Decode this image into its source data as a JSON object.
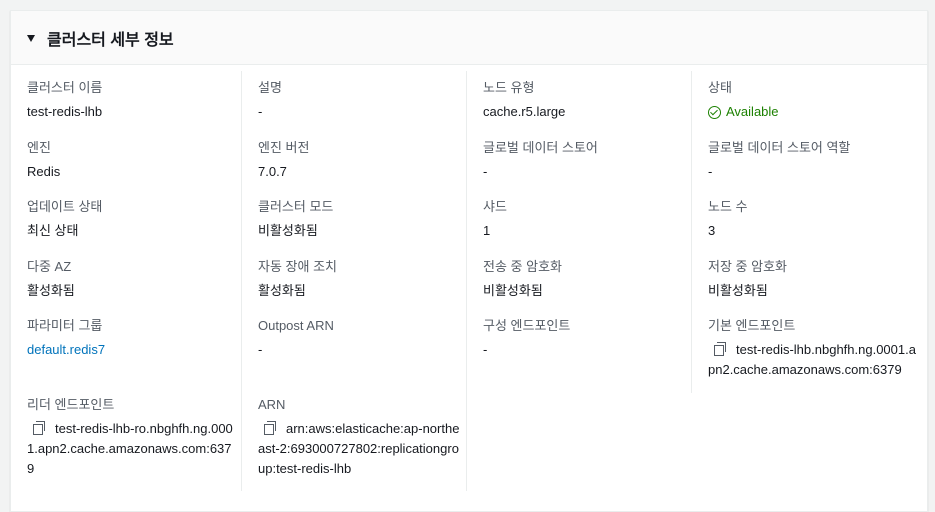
{
  "panel": {
    "title": "클러스터 세부 정보"
  },
  "fields": {
    "cluster_name": {
      "label": "클러스터 이름",
      "value": "test-redis-lhb"
    },
    "description": {
      "label": "설명",
      "value": "-"
    },
    "node_type": {
      "label": "노드 유형",
      "value": "cache.r5.large"
    },
    "status": {
      "label": "상태",
      "value": "Available"
    },
    "engine": {
      "label": "엔진",
      "value": "Redis"
    },
    "engine_version": {
      "label": "엔진 버전",
      "value": "7.0.7"
    },
    "global_datastore": {
      "label": "글로벌 데이터 스토어",
      "value": "-"
    },
    "global_datastore_role": {
      "label": "글로벌 데이터 스토어 역할",
      "value": "-"
    },
    "update_status": {
      "label": "업데이트 상태",
      "value": "최신 상태"
    },
    "cluster_mode": {
      "label": "클러스터 모드",
      "value": "비활성화됨"
    },
    "shards": {
      "label": "샤드",
      "value": "1"
    },
    "node_count": {
      "label": "노드 수",
      "value": "3"
    },
    "multi_az": {
      "label": "다중 AZ",
      "value": "활성화됨"
    },
    "auto_failover": {
      "label": "자동 장애 조치",
      "value": "활성화됨"
    },
    "transit_encryption": {
      "label": "전송 중 암호화",
      "value": "비활성화됨"
    },
    "at_rest_encryption": {
      "label": "저장 중 암호화",
      "value": "비활성화됨"
    },
    "parameter_group": {
      "label": "파라미터 그룹",
      "value": "default.redis7"
    },
    "outpost_arn": {
      "label": "Outpost ARN",
      "value": "-"
    },
    "config_endpoint": {
      "label": "구성 엔드포인트",
      "value": "-"
    },
    "primary_endpoint": {
      "label": "기본 엔드포인트",
      "value": "test-redis-lhb.nbghfh.ng.0001.apn2.cache.amazonaws.com:6379"
    },
    "reader_endpoint": {
      "label": "리더 엔드포인트",
      "value": "test-redis-lhb-ro.nbghfh.ng.0001.apn2.cache.amazonaws.com:6379"
    },
    "arn": {
      "label": "ARN",
      "value": "arn:aws:elasticache:ap-northeast-2:693000727802:replicationgroup:test-redis-lhb"
    }
  },
  "icons": {
    "collapse": "caret-down-icon",
    "status": "status-success-icon",
    "copy": "copy-icon"
  },
  "colors": {
    "link": "#0073bb",
    "success": "#1d8102",
    "label": "#545b64",
    "text": "#16191f"
  }
}
